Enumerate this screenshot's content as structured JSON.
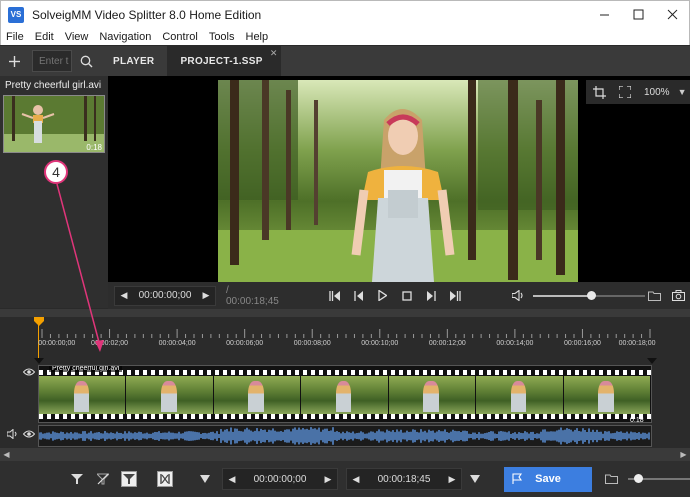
{
  "window": {
    "title": "SolveigMM Video Splitter 8.0 Home Edition",
    "logo_text": "VS"
  },
  "menu": [
    "File",
    "Edit",
    "View",
    "Navigation",
    "Control",
    "Tools",
    "Help"
  ],
  "toolbar": {
    "search_placeholder": "Enter t",
    "tabs": [
      {
        "label": "PLAYER",
        "active": false
      },
      {
        "label": "PROJECT-1.SSP",
        "active": true
      }
    ]
  },
  "media_panel": {
    "file_name": "Pretty cheerful girl.avi",
    "thumb_duration": "0:18"
  },
  "view_tools": {
    "zoom": "100%"
  },
  "transport": {
    "current_time": "00:00:00;00",
    "duration": "/ 00:00:18;45",
    "volume_level": 0.52
  },
  "timeline": {
    "ruler_ticks": [
      "00:00:00;00",
      "00:00:02;00",
      "00:00:04;00",
      "00:00:06;00",
      "00:00:08;00",
      "00:00:10;00",
      "00:00:12;00",
      "00:00:14;00",
      "00:00:16;00",
      "00:00:18;00"
    ],
    "video_track": {
      "name": "Pretty cheerful girl.avi",
      "duration": "0:18"
    }
  },
  "bottom_bar": {
    "start_time": "00:00:00;00",
    "end_time": "00:00:18;45",
    "save_label": "Save",
    "zoom_slider_level": 0.1
  },
  "callout": {
    "number": "4"
  },
  "colors": {
    "accent": "#3c7ee0",
    "playhead": "#f4a000",
    "callout": "#e0357a",
    "waveform": "#5b8fd6"
  }
}
